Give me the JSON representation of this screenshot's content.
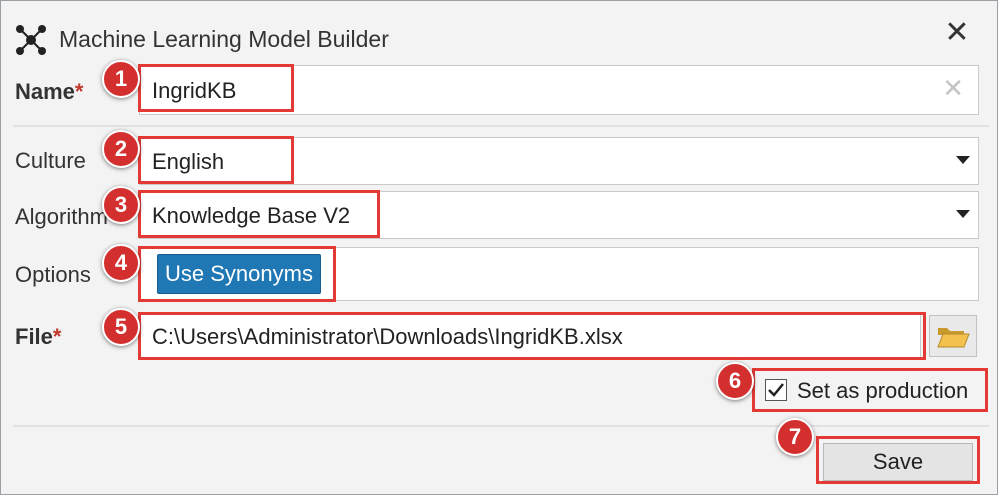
{
  "dialog": {
    "title": "Machine Learning Model Builder",
    "close_symbol": "✕",
    "icon": "network-nodes-icon"
  },
  "form": {
    "name_label": "Name",
    "name_value": "IngridKB",
    "clear_symbol": "✕",
    "culture_label": "Culture",
    "culture_value": "English",
    "algorithm_label": "Algorithm",
    "algorithm_value": "Knowledge Base V2",
    "options_label": "Options",
    "options_chip": "Use Synonyms",
    "file_label": "File",
    "file_value": "C:\\Users\\Administrator\\Downloads\\IngridKB.xlsx",
    "required_marker": "*",
    "production_label": "Set as production",
    "production_checked": true,
    "save_label": "Save"
  },
  "callouts": [
    "1",
    "2",
    "3",
    "4",
    "5",
    "6",
    "7"
  ],
  "colors": {
    "callout": "#d32f2f",
    "highlight": "#e53935",
    "chip": "#1f77b4",
    "required": "#c0392b"
  }
}
